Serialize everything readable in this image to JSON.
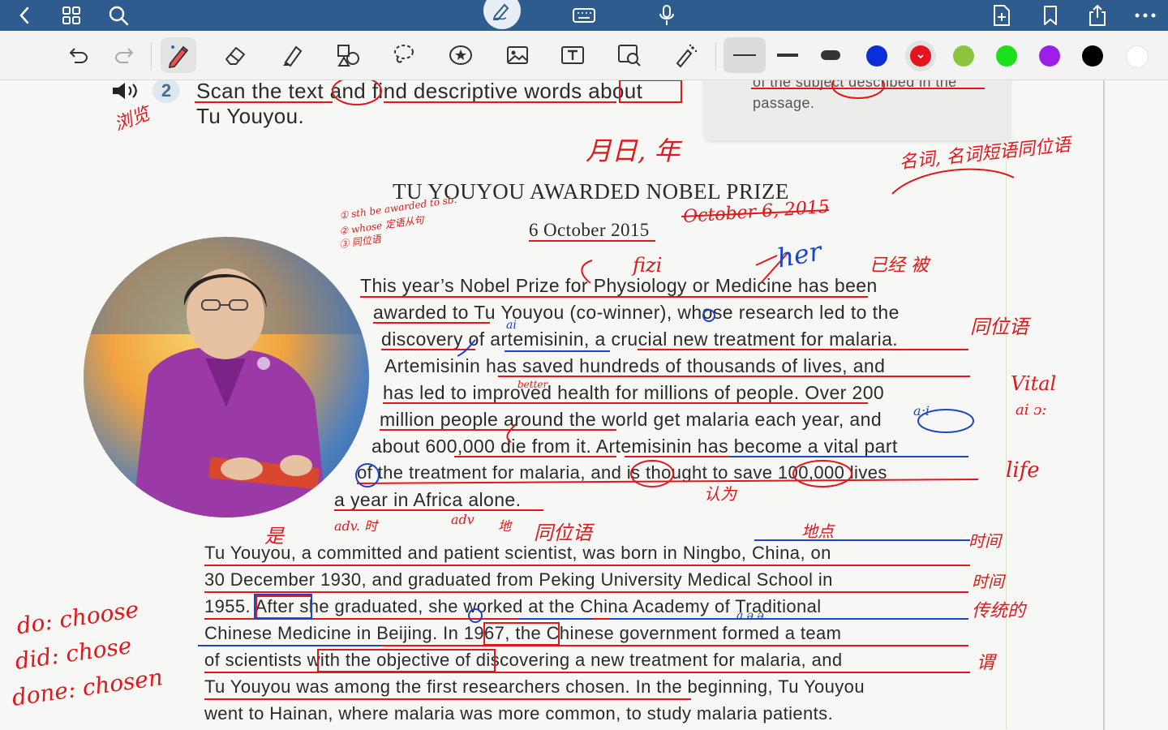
{
  "colors": {
    "topbar": "#2e5c8f",
    "toolbar": "#f3f3f3",
    "ink_red": "#e0181c",
    "ink_blue": "#1c46c8",
    "swatches": [
      "#0a2fd8",
      "#e4141a",
      "#8cc43e",
      "#1be01b",
      "#9b1fe6",
      "#000000",
      "#ffffff"
    ]
  },
  "topbar": {
    "icons": [
      "back-icon",
      "grid-icon",
      "search-icon",
      "pen-mode-icon",
      "keyboard-icon",
      "microphone-icon",
      "add-page-icon",
      "bookmark-icon",
      "share-icon",
      "more-icon"
    ]
  },
  "toolbar": {
    "tools": [
      "undo-icon",
      "redo-icon",
      "pen-tool-icon",
      "eraser-icon",
      "highlighter-icon",
      "shapes-icon",
      "lasso-icon",
      "sticker-icon",
      "image-icon",
      "text-box-icon",
      "zoom-window-icon",
      "laser-pointer-icon"
    ],
    "selected_color": "red"
  },
  "page": {
    "task_number": "2",
    "task_line1": "Scan the text and find descriptive words about",
    "task_line2": "Tu Youyou.",
    "sidebar_line1": "of the subject described in the",
    "sidebar_line2": "passage.",
    "article_title": "TU YOUYOU AWARDED NOBEL PRIZE",
    "article_date": "6 October 2015",
    "para1": [
      "This year’s Nobel Prize for Physiology or Medicine has been",
      "awarded to Tu Youyou (co-winner), whose research led to the",
      "discovery of artemisinin, a crucial new treatment for malaria.",
      "Artemisinin has saved hundreds of thousands of lives, and",
      "has led to improved health for millions of people. Over 200",
      "million people around the world get malaria each year, and",
      "about 600,000 die from it. Artemisinin has become a vital part",
      "of the treatment for malaria, and is thought to save 100,000 lives",
      "a year in Africa alone."
    ],
    "para2": [
      "Tu Youyou, a committed and patient scientist, was born in Ningbo, China, on",
      "30 December 1930, and graduated from Peking University Medical School in",
      "1955. After she graduated, she worked at the China Academy of Traditional",
      "Chinese Medicine in Beijing. In 1967, the Chinese government formed a team",
      "of scientists with the objective of discovering a new treatment for malaria, and",
      "Tu Youyou was among the first researchers chosen. In the beginning, Tu Youyou",
      "went to Hainan, where malaria was more common, to study malaria patients."
    ]
  },
  "annotations": {
    "red": [
      "浏览",
      "月日, 年",
      "October 6, 2015",
      "① sth be awarded to sb.",
      "② whose 定语从句",
      "③ 同位语",
      "fizi",
      "已经 被",
      "同位语",
      "better",
      "认为",
      "Vital",
      "ai ɔ:",
      "life",
      "adv. 时",
      "adv",
      "地",
      "同位语",
      "是",
      "地点",
      "时间",
      "时间",
      "传统的",
      "谓",
      "do: choose",
      "did: chose",
      "done: chosen",
      "名词, 名词短语同位语"
    ],
    "blue": [
      "her",
      "ai",
      "a:i",
      "a ə ə"
    ]
  }
}
